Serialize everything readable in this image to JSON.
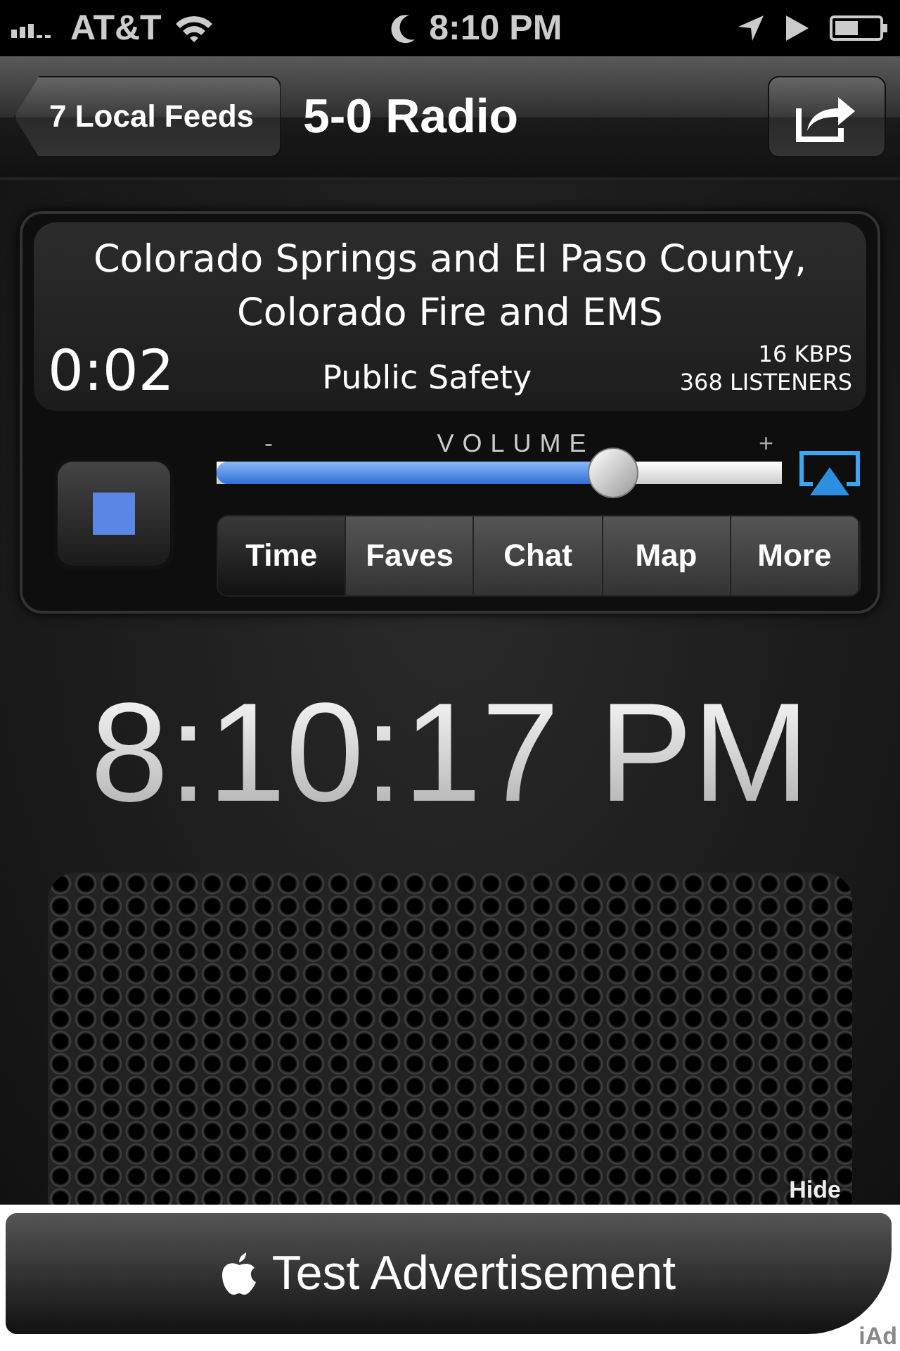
{
  "status_bar": {
    "carrier": "AT&T",
    "time": "8:10 PM"
  },
  "nav_bar": {
    "back": "7 Local Feeds",
    "title": "5-0 Radio"
  },
  "player": {
    "station": "Colorado Springs and El Paso County, Colorado Fire and EMS",
    "elapsed": "0:02",
    "genre": "Public Safety",
    "bitrate": "16 KBPS",
    "listeners": "368 LISTENERS",
    "playing": true,
    "volume": {
      "label": "VOLUME",
      "min": "-",
      "max": "+",
      "level": 0.72
    },
    "tabs": [
      {
        "label": "Time",
        "selected": true
      },
      {
        "label": "Faves",
        "selected": false
      },
      {
        "label": "Chat",
        "selected": false
      },
      {
        "label": "Map",
        "selected": false
      },
      {
        "label": "More",
        "selected": false
      }
    ]
  },
  "clock": "8:10:17 PM",
  "speaker": {
    "hide": "Hide"
  },
  "ad": {
    "text": "Test Advertisement",
    "badge": "iAd"
  }
}
